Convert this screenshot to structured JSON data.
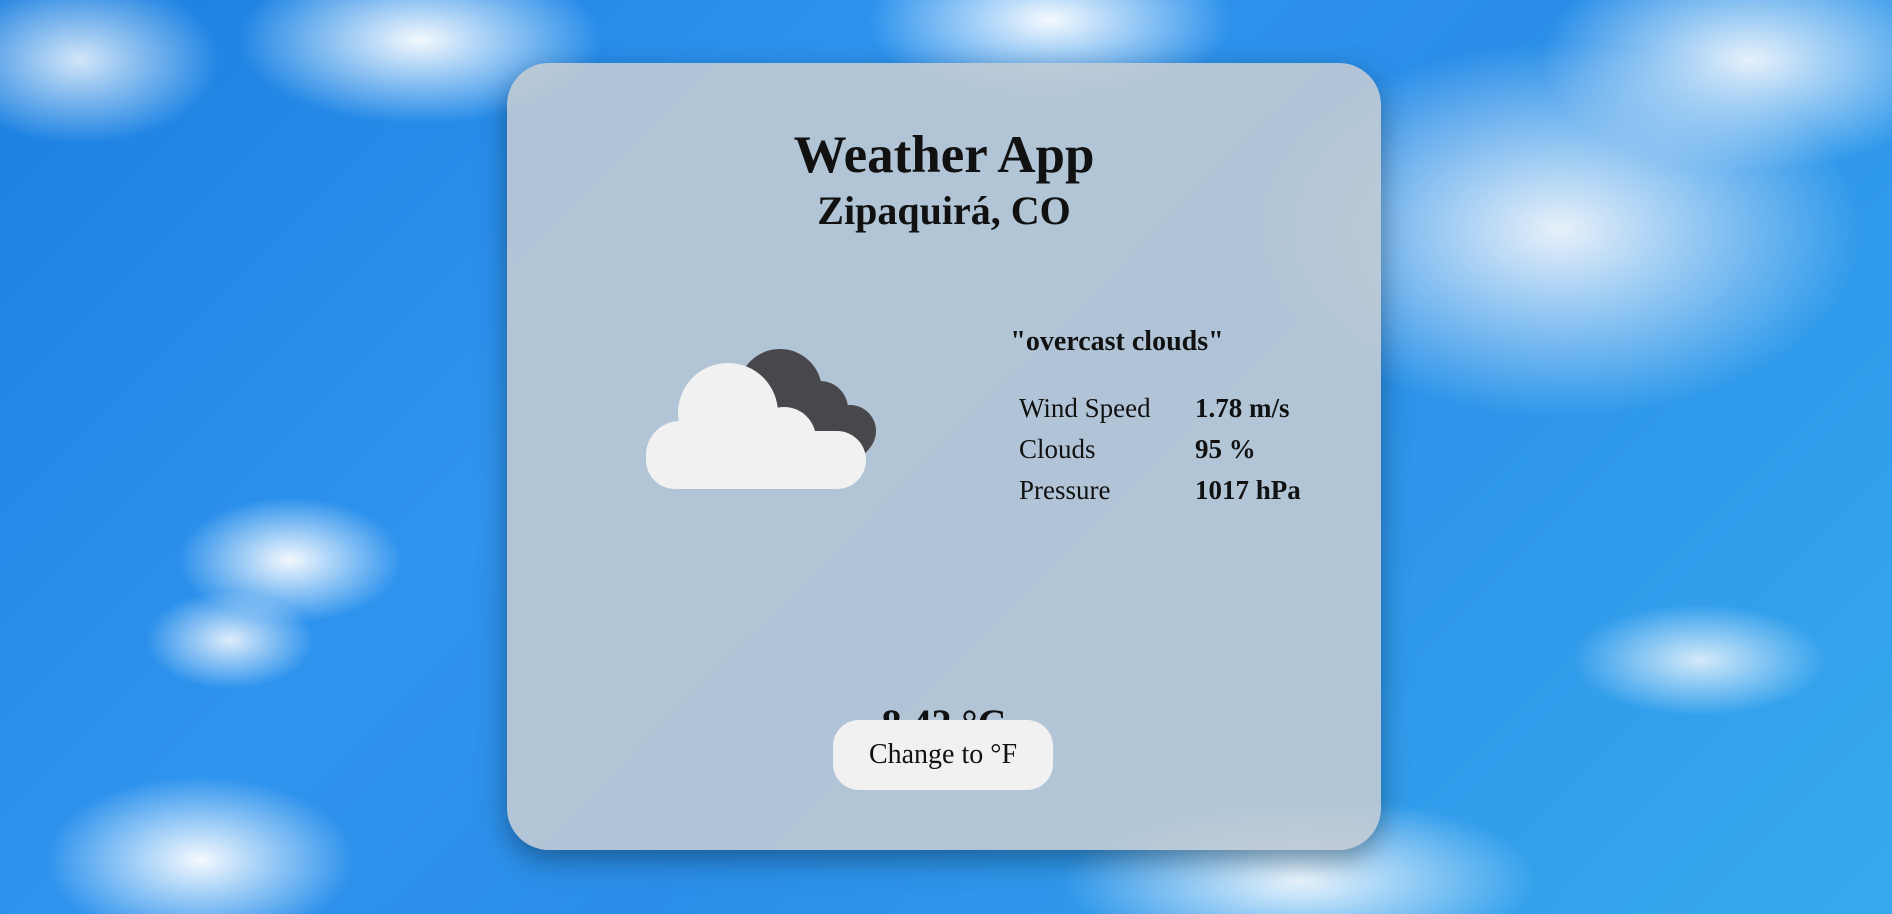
{
  "app": {
    "title": "Weather App",
    "location": "Zipaquirá, CO"
  },
  "weather": {
    "icon": "overcast-clouds-icon",
    "description": "\"overcast clouds\"",
    "details": [
      {
        "label": "Wind Speed",
        "value": "1.78 m/s"
      },
      {
        "label": "Clouds",
        "value": "95 %"
      },
      {
        "label": "Pressure",
        "value": "1017 hPa"
      }
    ],
    "temperature": "8.42 °C"
  },
  "controls": {
    "unit_toggle_label": "Change to °F"
  },
  "colors": {
    "cloud_front": "#f1f1f1",
    "cloud_back": "#48484c",
    "card_background": "#c4ccd4"
  }
}
